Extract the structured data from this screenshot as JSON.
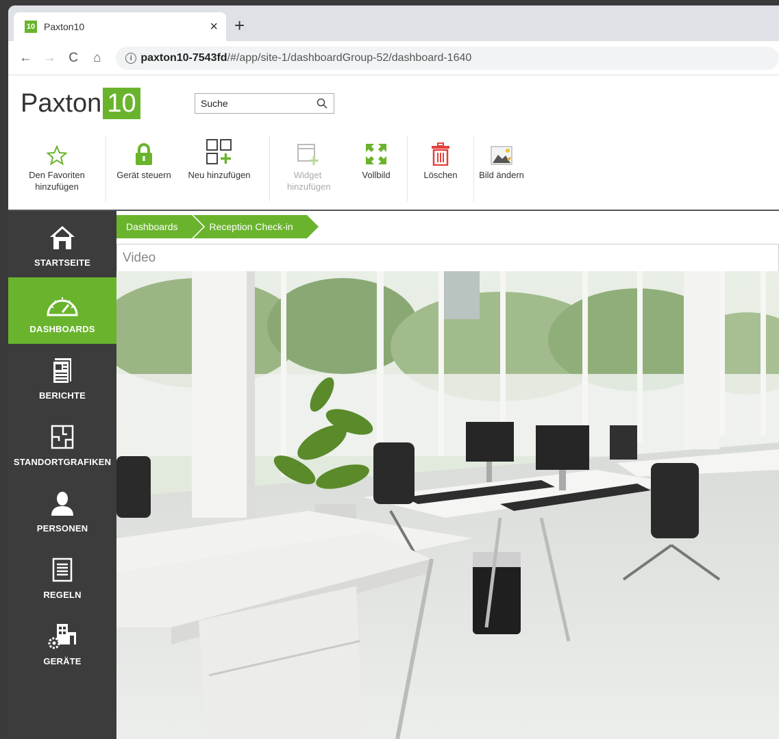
{
  "browser": {
    "tab_title": "Paxton10",
    "favicon_text": "10",
    "tab_close": "×",
    "new_tab": "+",
    "nav": {
      "back": "←",
      "forward": "→",
      "reload": "C",
      "home": "⌂"
    },
    "info": "i",
    "url_host": "paxton10-7543fd",
    "url_path": "/#/app/site-1/dashboardGroup-52/dashboard-1640"
  },
  "app": {
    "logo_text": "Paxton",
    "logo_num": "10",
    "search_placeholder": "Suche",
    "accent": "#6ab42d",
    "toolbar": [
      {
        "id": "favorite",
        "label": "Den Favoriten hinzufügen",
        "icon": "star-icon"
      },
      {
        "id": "control",
        "label": "Gerät steuern",
        "icon": "lock-icon"
      },
      {
        "id": "new",
        "label": "Neu hinzufügen",
        "icon": "grid-add-icon"
      },
      {
        "id": "widget",
        "label": "Widget hinzufügen",
        "icon": "window-add-icon",
        "disabled": true
      },
      {
        "id": "fullscreen",
        "label": "Vollbild",
        "icon": "fullscreen-icon"
      },
      {
        "id": "delete",
        "label": "Löschen",
        "icon": "trash-icon"
      },
      {
        "id": "image",
        "label": "Bild ändern",
        "icon": "image-icon"
      }
    ]
  },
  "sidebar": {
    "items": [
      {
        "label": "STARTSEITE",
        "icon": "home-icon"
      },
      {
        "label": "DASHBOARDS",
        "icon": "gauge-icon",
        "active": true
      },
      {
        "label": "BERICHTE",
        "icon": "report-icon"
      },
      {
        "label": "STANDORTGRAFIKEN",
        "icon": "floorplan-icon"
      },
      {
        "label": "PERSONEN",
        "icon": "person-icon"
      },
      {
        "label": "REGELN",
        "icon": "rules-icon"
      },
      {
        "label": "GERÄTE",
        "icon": "devices-icon"
      }
    ]
  },
  "main": {
    "breadcrumb": [
      "Dashboards",
      "Reception Check-in"
    ],
    "widget_title": "Video"
  }
}
